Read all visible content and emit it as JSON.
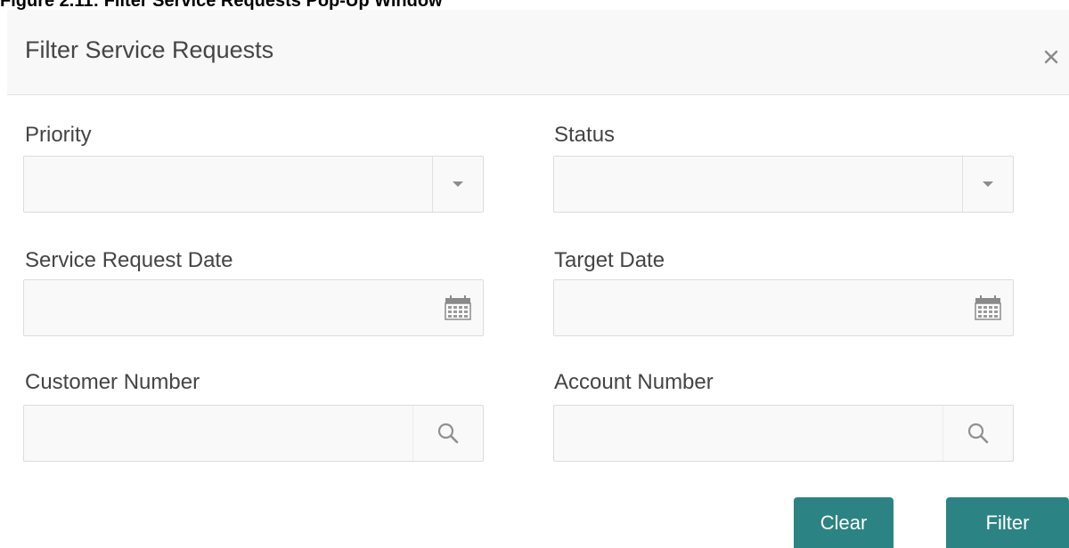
{
  "caption": "Figure 2.11: Filter Service Requests Pop-Up Window",
  "modal": {
    "title": "Filter Service Requests",
    "close_icon": "close-icon"
  },
  "fields": {
    "priority": {
      "label": "Priority",
      "value": "",
      "icon": "chevron-down-icon"
    },
    "status": {
      "label": "Status",
      "value": "",
      "icon": "chevron-down-icon"
    },
    "service_request_date": {
      "label": "Service Request Date",
      "value": "",
      "icon": "calendar-icon"
    },
    "target_date": {
      "label": "Target Date",
      "value": "",
      "icon": "calendar-icon"
    },
    "customer_number": {
      "label": "Customer Number",
      "value": "",
      "icon": "search-icon"
    },
    "account_number": {
      "label": "Account Number",
      "value": "",
      "icon": "search-icon"
    }
  },
  "buttons": {
    "clear": "Clear",
    "filter": "Filter"
  },
  "colors": {
    "button_bg": "#2b8483",
    "header_bg": "#f8f8f8",
    "input_bg": "#f9f9f9"
  }
}
